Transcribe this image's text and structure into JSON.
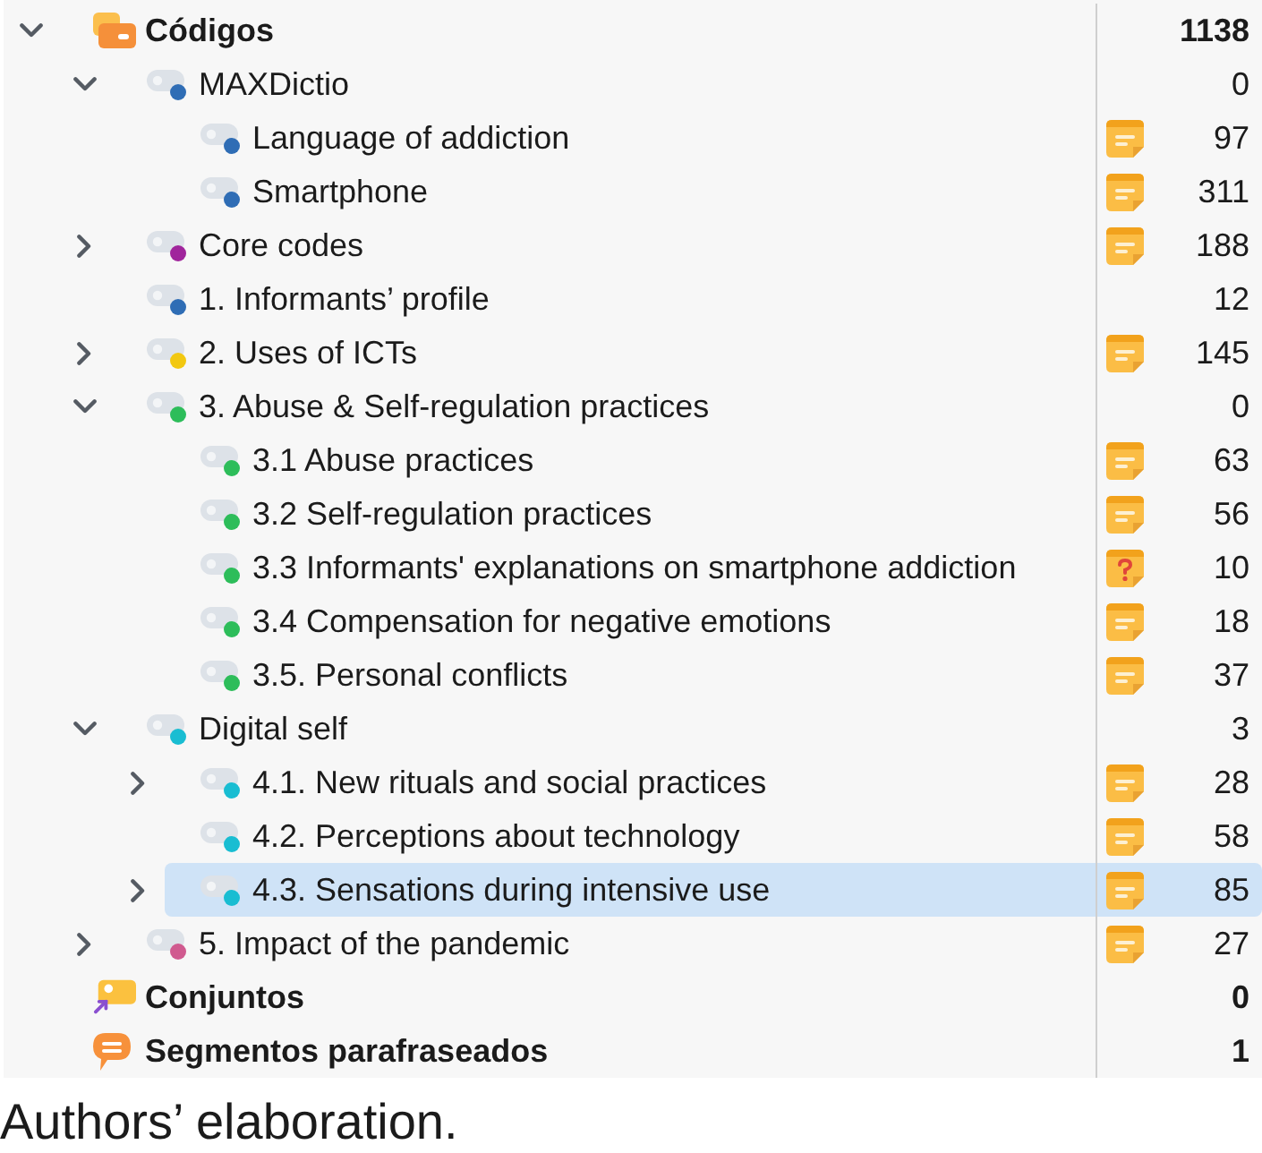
{
  "codes": {
    "label": "Códigos",
    "count": "1138",
    "expanded": true,
    "selected": false,
    "children": [
      {
        "label": "MAXDictio",
        "color": "#2f6db5",
        "count": "0",
        "expanded": true,
        "selected": false,
        "children": [
          {
            "label": "Language of addiction",
            "color": "#2f6db5",
            "count": "97",
            "memo": {
              "kind": "note"
            },
            "selected": false
          },
          {
            "label": "Smartphone",
            "color": "#2f6db5",
            "count": "311",
            "memo": {
              "kind": "note"
            },
            "selected": false
          }
        ]
      },
      {
        "label": "Core codes",
        "color": "#a0259c",
        "count": "188",
        "memo": {
          "kind": "note"
        },
        "expanded": false,
        "selected": false
      },
      {
        "label": "1. Informants’ profile",
        "color": "#2f6db5",
        "count": "12",
        "selected": false
      },
      {
        "label": "2. Uses of ICTs",
        "color": "#f2c811",
        "count": "145",
        "memo": {
          "kind": "note"
        },
        "expanded": false,
        "selected": false
      },
      {
        "label": "3. Abuse & Self-regulation practices",
        "color": "#2dbd5a",
        "count": "0",
        "expanded": true,
        "selected": false,
        "children": [
          {
            "label": "3.1 Abuse practices",
            "color": "#2dbd5a",
            "count": "63",
            "memo": {
              "kind": "note"
            },
            "selected": false
          },
          {
            "label": "3.2 Self-regulation practices",
            "color": "#2dbd5a",
            "count": "56",
            "memo": {
              "kind": "note"
            },
            "selected": false
          },
          {
            "label": "3.3 Informants' explanations on smartphone addiction",
            "color": "#2dbd5a",
            "count": "10",
            "memo": {
              "kind": "question"
            },
            "selected": false
          },
          {
            "label": "3.4 Compensation for negative emotions",
            "color": "#2dbd5a",
            "count": "18",
            "memo": {
              "kind": "note"
            },
            "selected": false
          },
          {
            "label": "3.5. Personal conflicts",
            "color": "#2dbd5a",
            "count": "37",
            "memo": {
              "kind": "note"
            },
            "selected": false
          }
        ]
      },
      {
        "label": "Digital self",
        "color": "#19bdd2",
        "count": "3",
        "expanded": true,
        "selected": false,
        "children": [
          {
            "label": "4.1. New rituals and social practices",
            "color": "#19bdd2",
            "count": "28",
            "memo": {
              "kind": "note"
            },
            "expanded": false,
            "selected": false
          },
          {
            "label": "4.2. Perceptions about technology",
            "color": "#19bdd2",
            "count": "58",
            "memo": {
              "kind": "note"
            },
            "selected": false
          },
          {
            "label": "4.3. Sensations during intensive use",
            "color": "#19bdd2",
            "count": "85",
            "memo": {
              "kind": "note"
            },
            "expanded": false,
            "selected": true
          }
        ]
      },
      {
        "label": "5. Impact of the pandemic",
        "color": "#d05a8f",
        "count": "27",
        "memo": {
          "kind": "note"
        },
        "expanded": false,
        "selected": false
      }
    ]
  },
  "sets": {
    "label": "Conjuntos",
    "count": "0",
    "selected": false
  },
  "paraphrased_segments": {
    "label": "Segmentos parafraseados",
    "count": "1",
    "selected": false
  },
  "caption": "Authors’ elaboration."
}
